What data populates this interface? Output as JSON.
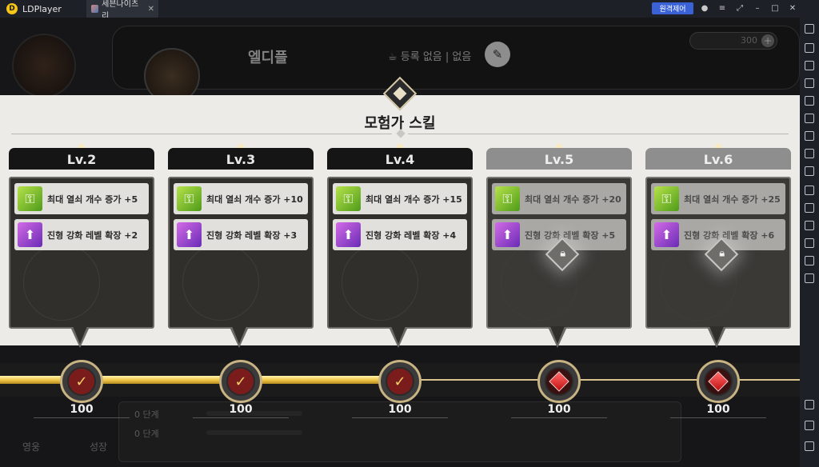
{
  "window": {
    "app_name": "LDPlayer",
    "tab_title": "세븐나이츠 리",
    "remote_label": "원격제어"
  },
  "game": {
    "profile_name": "엘디플",
    "registration": "☕ 등록 없음 | 없음",
    "currency": "300",
    "stages": [
      "0 단계",
      "0 단계"
    ],
    "bottom_left": [
      "영웅",
      "성장"
    ]
  },
  "modal": {
    "title": "모험가 스킬",
    "levels": [
      {
        "label": "Lv.2",
        "locked": false,
        "skills": [
          "최대 열쇠 개수 증가 +5",
          "진형 강화 레벨 확장 +2"
        ],
        "value": "100",
        "completed": true
      },
      {
        "label": "Lv.3",
        "locked": false,
        "skills": [
          "최대 열쇠 개수 증가 +10",
          "진형 강화 레벨 확장 +3"
        ],
        "value": "100",
        "completed": true
      },
      {
        "label": "Lv.4",
        "locked": false,
        "skills": [
          "최대 열쇠 개수 증가 +15",
          "진형 강화 레벨 확장 +4"
        ],
        "value": "100",
        "completed": true
      },
      {
        "label": "Lv.5",
        "locked": true,
        "skills": [
          "최대 열쇠 개수 증가 +20",
          "진형 강화 레벨 확장 +5"
        ],
        "value": "100",
        "completed": false
      },
      {
        "label": "Lv.6",
        "locked": true,
        "skills": [
          "최대 열쇠 개수 증가 +25",
          "진형 강화 레벨 확장 +6"
        ],
        "value": "100",
        "completed": false
      }
    ]
  },
  "icons": {
    "skill_key": "key-icon",
    "skill_upgrade": "upgrade-icon",
    "lock": "lock-icon",
    "node_done": "checkmark-icon",
    "node_pending": "red-gem-icon"
  },
  "colors": {
    "accent_gold": "#f2c94c",
    "remote_button": "#3a62d6"
  }
}
